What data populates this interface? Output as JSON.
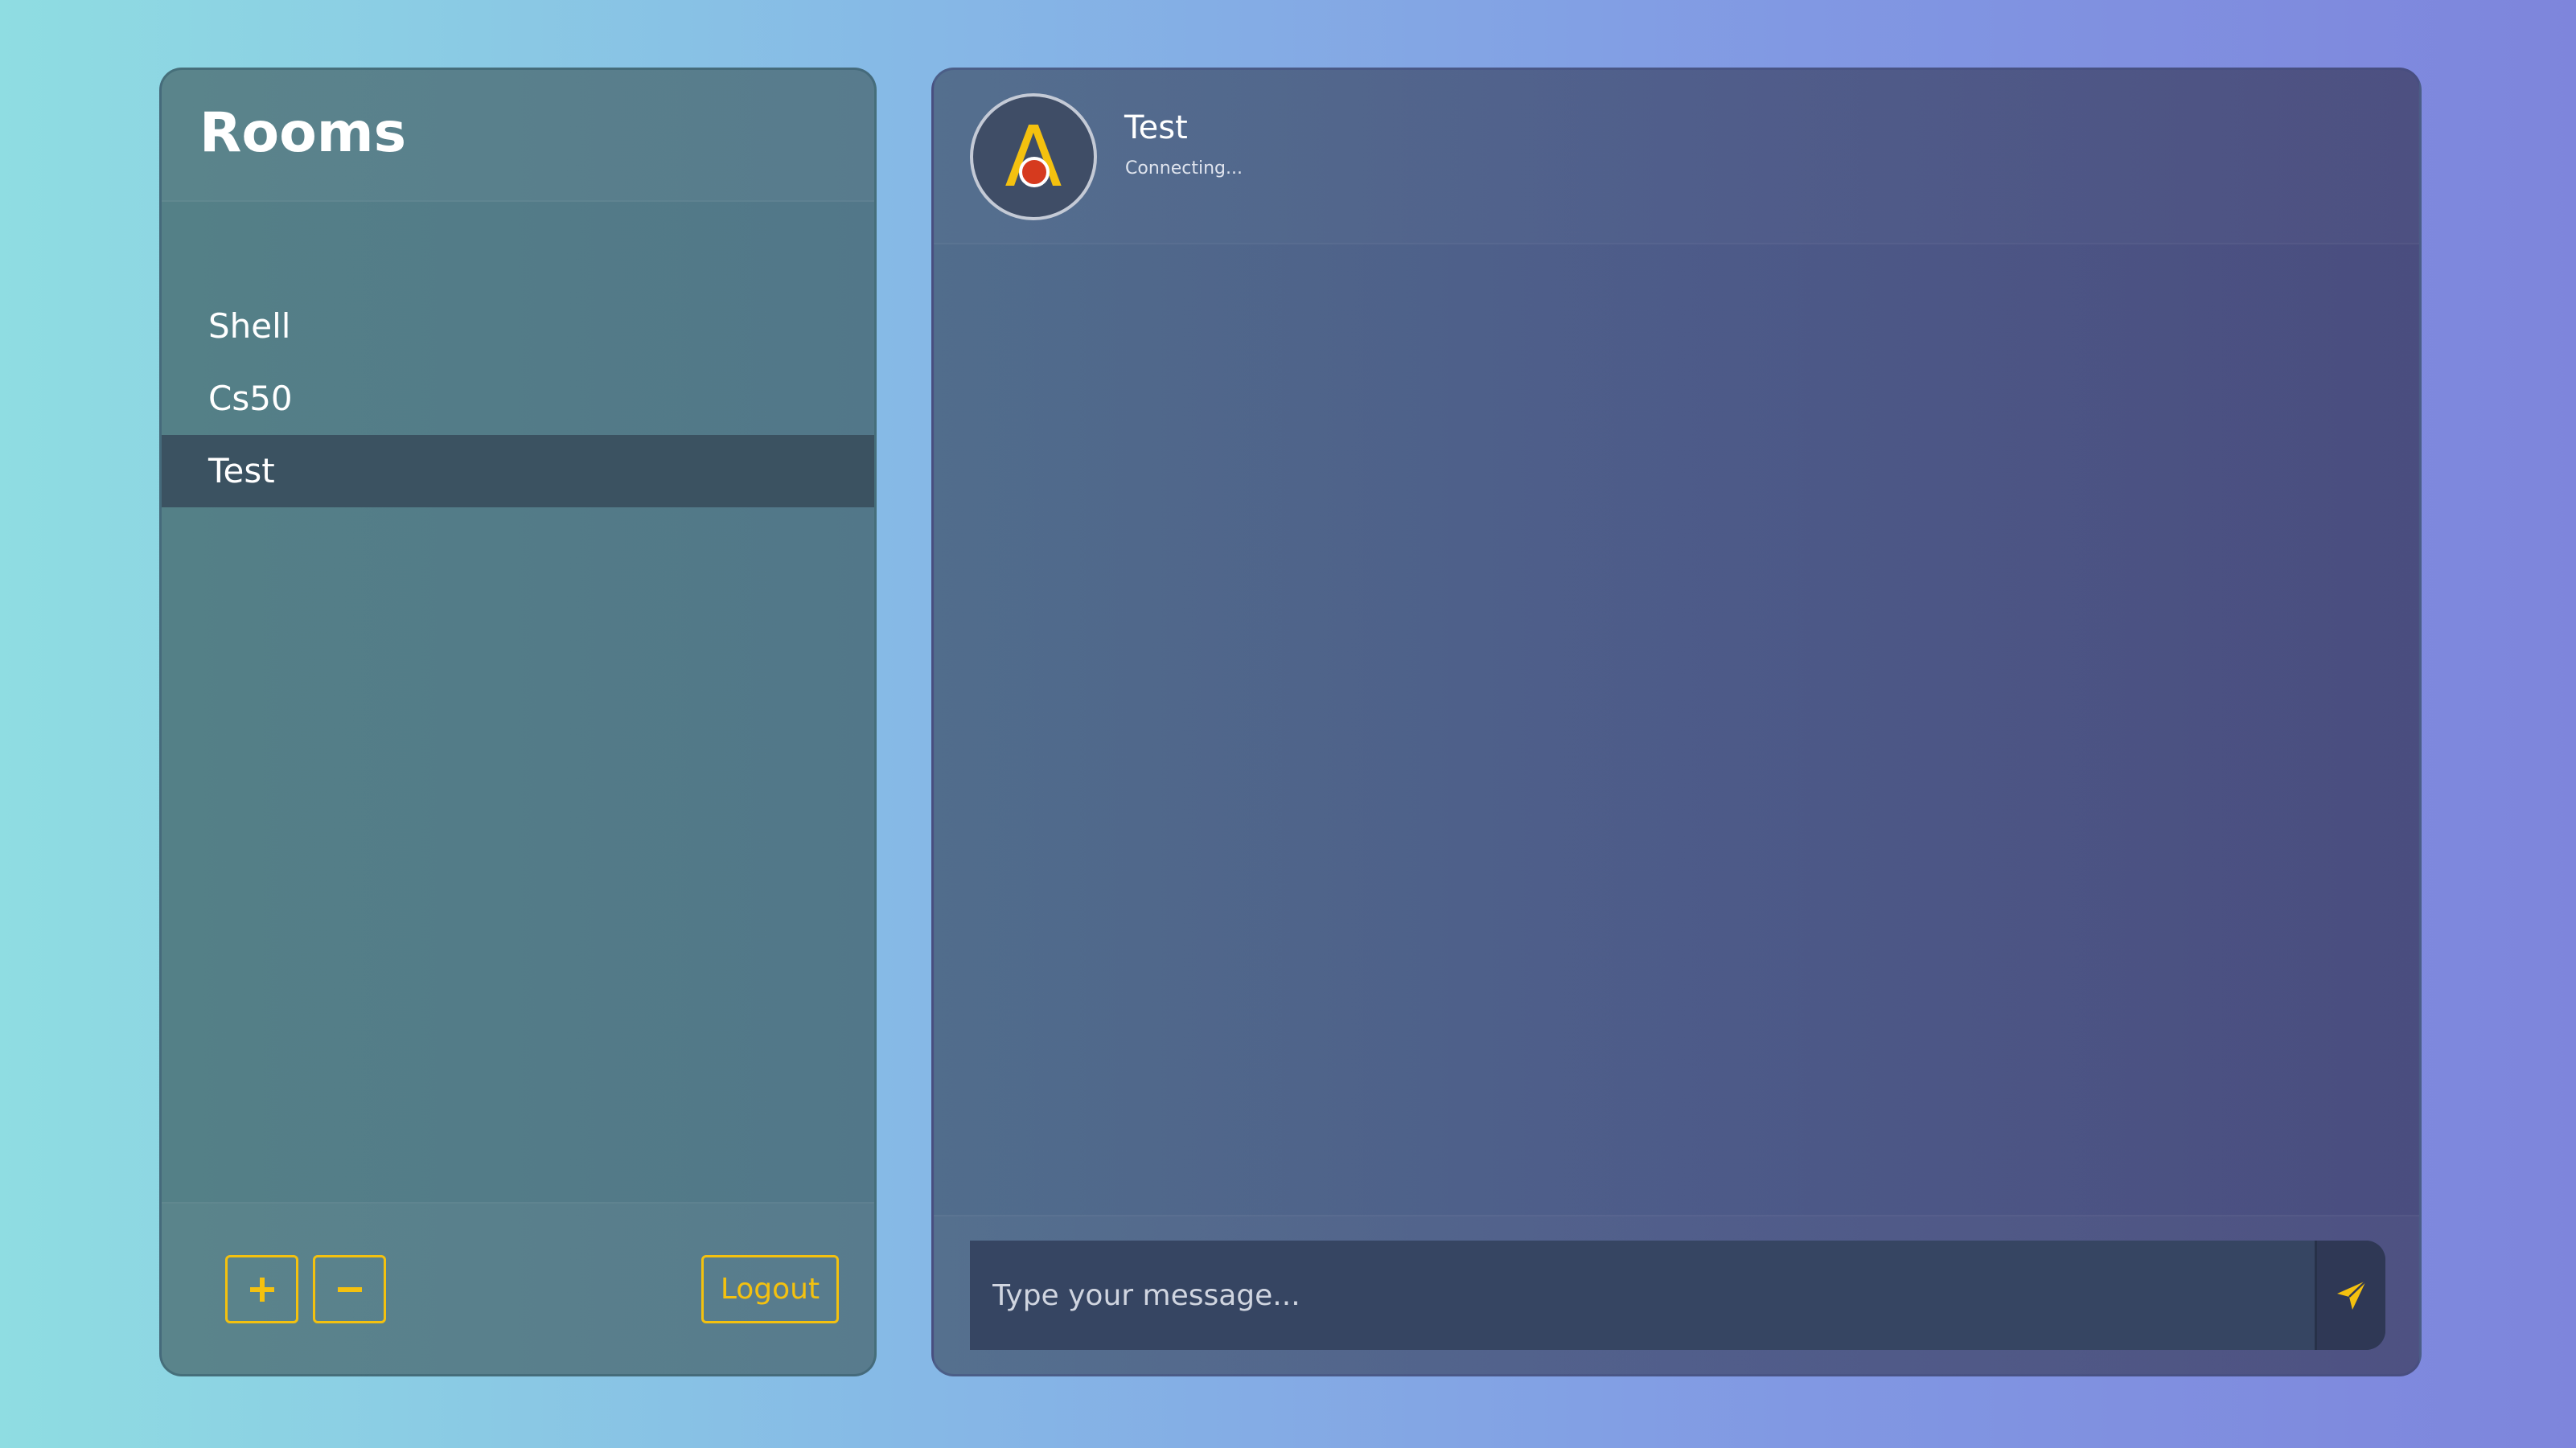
{
  "sidebar": {
    "title": "Rooms",
    "rooms": [
      {
        "name": "Shell",
        "active": false
      },
      {
        "name": "Cs50",
        "active": false
      },
      {
        "name": "Test",
        "active": true
      }
    ],
    "footer": {
      "add_icon": "plus-icon",
      "remove_icon": "minus-icon",
      "logout_label": "Logout"
    }
  },
  "chat": {
    "avatar_letter": "A",
    "room_name": "Test",
    "status": "Connecting...",
    "status_color": "#d63a1e",
    "composer": {
      "placeholder": "Type your message...",
      "value": "",
      "send_icon": "paper-plane-icon"
    }
  },
  "colors": {
    "accent": "#f4c10f",
    "active_room_bg": "#3b5261"
  }
}
